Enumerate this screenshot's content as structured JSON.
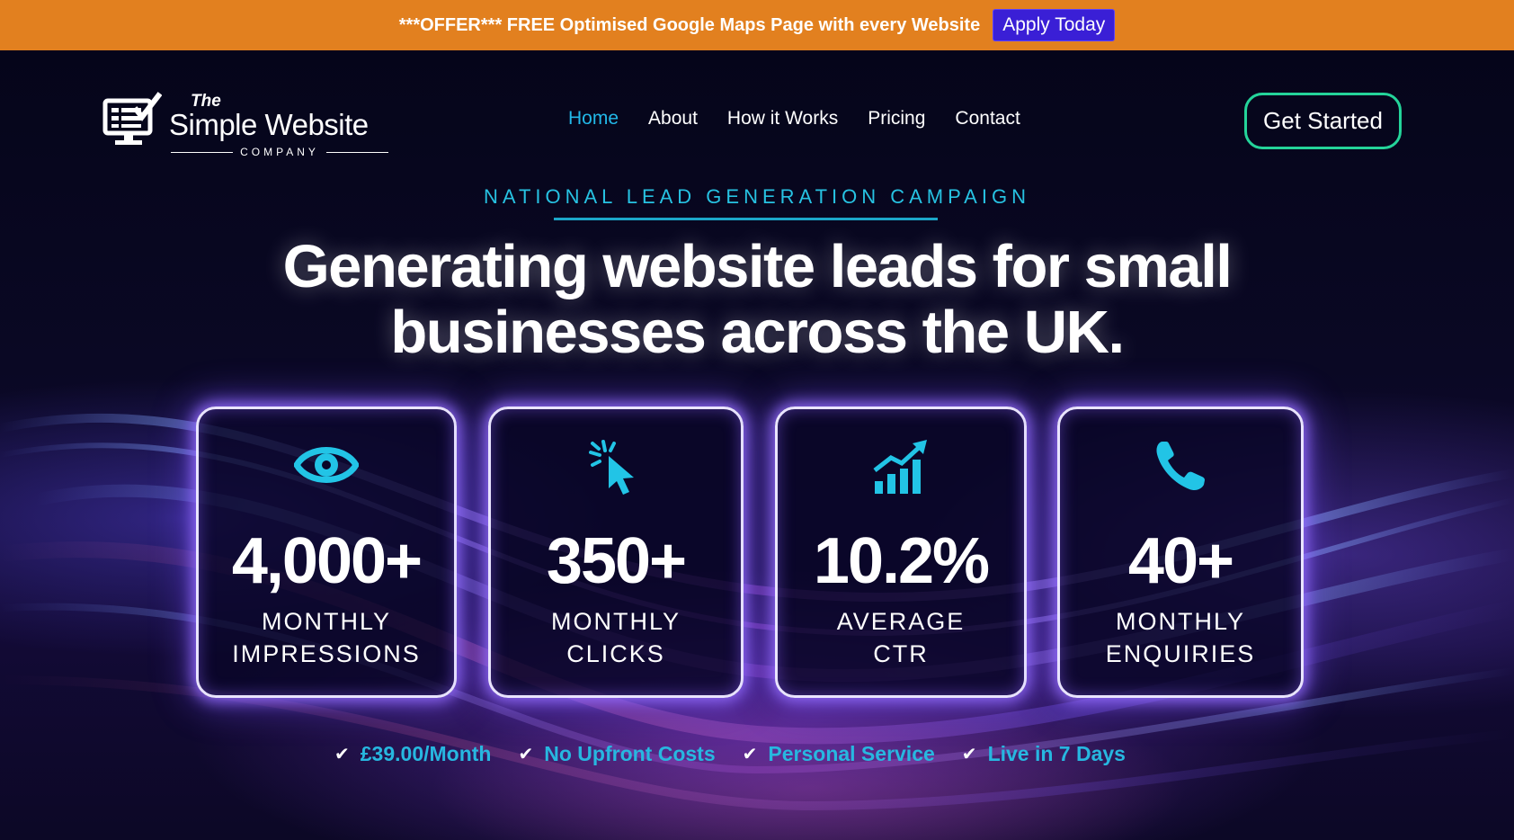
{
  "announcement": {
    "text": "***OFFER*** FREE Optimised Google Maps Page with every Website",
    "button_label": "Apply Today"
  },
  "logo": {
    "the": "The",
    "name": "Simple Website",
    "company": "COMPANY",
    "icon": "monitor-checklist-icon"
  },
  "nav": {
    "items": [
      {
        "label": "Home",
        "active": true
      },
      {
        "label": "About",
        "active": false
      },
      {
        "label": "How it Works",
        "active": false
      },
      {
        "label": "Pricing",
        "active": false
      },
      {
        "label": "Contact",
        "active": false
      }
    ],
    "cta_label": "Get Started"
  },
  "hero": {
    "eyebrow": "NATIONAL LEAD GENERATION CAMPAIGN",
    "headline_line1": "Generating website leads for small",
    "headline_line2": "businesses across the UK."
  },
  "stats": [
    {
      "icon": "eye-icon",
      "value": "4,000+",
      "label_line1": "MONTHLY",
      "label_line2": "IMPRESSIONS"
    },
    {
      "icon": "cursor-click-icon",
      "value": "350+",
      "label_line1": "MONTHLY",
      "label_line2": "CLICKS"
    },
    {
      "icon": "growth-chart-icon",
      "value": "10.2%",
      "label_line1": "AVERAGE",
      "label_line2": "CTR"
    },
    {
      "icon": "phone-icon",
      "value": "40+",
      "label_line1": "MONTHLY",
      "label_line2": "ENQUIRIES"
    }
  ],
  "features": [
    "£39.00/Month",
    "No Upfront Costs",
    "Personal Service",
    "Live in 7 Days"
  ],
  "colors": {
    "offer_bar": "#e2801f",
    "apply_button": "#3a1fd6",
    "accent_cyan": "#22b8e8",
    "cta_border": "#24d49a",
    "background": "#07061a"
  }
}
